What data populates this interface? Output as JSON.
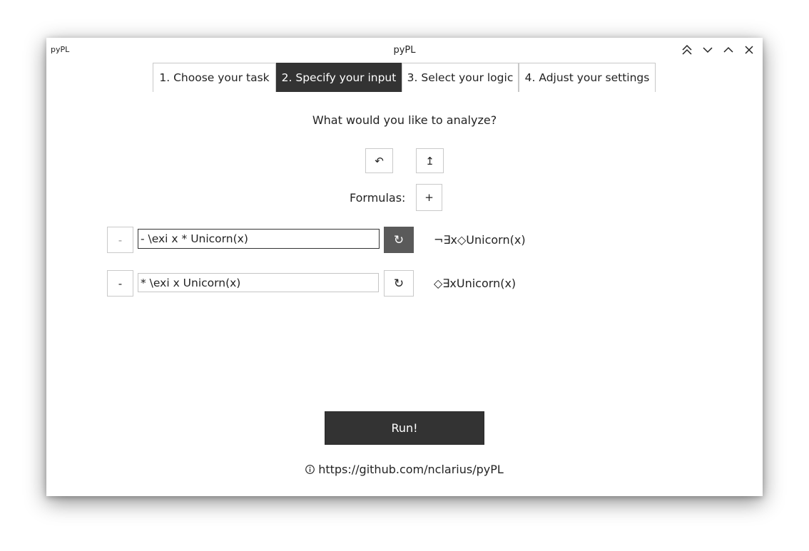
{
  "window": {
    "app_label": "pyPL",
    "title": "pyPL"
  },
  "tabs": [
    {
      "label": "1. Choose your task"
    },
    {
      "label": "2. Specify your input"
    },
    {
      "label": "3. Select your logic"
    },
    {
      "label": "4. Adjust your settings"
    }
  ],
  "active_tab": "2. Specify your input",
  "main": {
    "prompt": "What would you like to analyze?",
    "undo_icon": "↶",
    "upload_icon": "↥",
    "formulas_label": "Formulas:",
    "add_label": "+",
    "formulas": [
      {
        "remove_label": "-",
        "input": "- \\exi x * Unicorn(x)",
        "refresh_icon": "↻",
        "rendered": "¬∃x◇Unicorn(x)"
      },
      {
        "remove_label": "-",
        "input": "* \\exi x Unicorn(x)",
        "refresh_icon": "↻",
        "rendered": "◇∃xUnicorn(x)"
      }
    ],
    "run_label": "Run!",
    "link": "https://github.com/nclarius/pyPL"
  },
  "colors": {
    "dark_accent": "#333333",
    "refresh_active": "#5a5a5a",
    "text": "#232323",
    "border": "#c9c9c9"
  },
  "icons": {
    "minimize_all": "double-chevron-up-icon",
    "minimize": "chevron-down-icon",
    "maximize": "chevron-up-icon",
    "close": "close-icon",
    "info": "info-icon"
  }
}
